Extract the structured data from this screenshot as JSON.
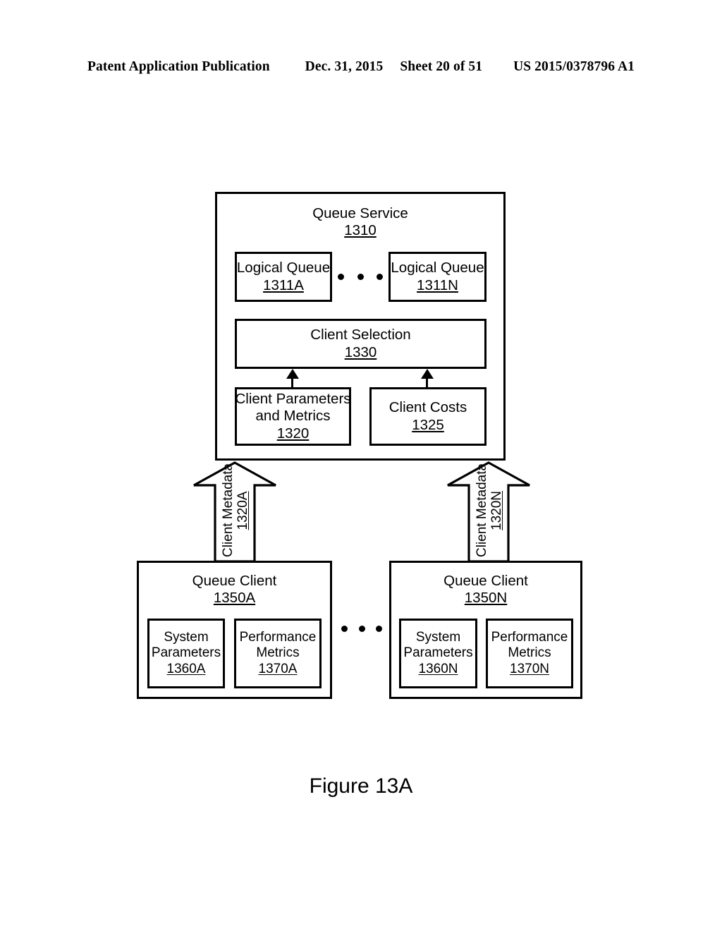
{
  "header": {
    "publication": "Patent Application Publication",
    "date": "Dec. 31, 2015",
    "sheet": "Sheet 20 of 51",
    "patent_number": "US 2015/0378796 A1"
  },
  "figure": {
    "caption": "Figure 13A"
  },
  "diagram": {
    "queue_service": {
      "label": "Queue Service",
      "number": "1310",
      "logical_queues": [
        {
          "label": "Logical Queue",
          "number": "1311A"
        },
        {
          "label": "Logical Queue",
          "number": "1311N"
        }
      ],
      "ellipsis": "• • •",
      "client_selection": {
        "label": "Client Selection",
        "number": "1330"
      },
      "client_parameters": {
        "label_line1": "Client Parameters",
        "label_line2": "and Metrics",
        "number": "1320"
      },
      "client_costs": {
        "label": "Client Costs",
        "number": "1325"
      }
    },
    "metadata_arrows": [
      {
        "label": "Client Metadata",
        "number": "1320A"
      },
      {
        "label": "Client Metadata",
        "number": "1320N"
      }
    ],
    "queue_clients": [
      {
        "label": "Queue Client",
        "number": "1350A",
        "system_parameters": {
          "label_line1": "System",
          "label_line2": "Parameters",
          "number": "1360A"
        },
        "performance_metrics": {
          "label_line1": "Performance",
          "label_line2": "Metrics",
          "number": "1370A"
        }
      },
      {
        "label": "Queue Client",
        "number": "1350N",
        "system_parameters": {
          "label_line1": "System",
          "label_line2": "Parameters",
          "number": "1360N"
        },
        "performance_metrics": {
          "label_line1": "Performance",
          "label_line2": "Metrics",
          "number": "1370N"
        }
      }
    ],
    "clients_ellipsis": "• • •"
  },
  "colors": {
    "line": "#000000",
    "background": "#ffffff"
  }
}
